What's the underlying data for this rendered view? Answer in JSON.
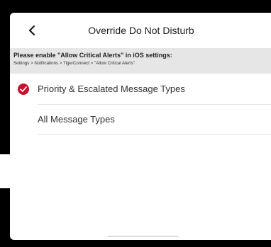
{
  "nav": {
    "title": "Override Do Not Disturb",
    "back_icon": "chevron-left-icon"
  },
  "banner": {
    "title": "Please enable \"Allow Critical Alerts\" in iOS settings:",
    "path": "Settings > Notifications > TigerConnect > \"Allow Critical Alerts\""
  },
  "options": [
    {
      "label": "Priority & Escalated Message Types",
      "selected": true,
      "icon": "check-circle-icon"
    },
    {
      "label": "All Message Types",
      "selected": false
    }
  ],
  "colors": {
    "accent": "#c8102e",
    "banner_bg": "#e6e6e6"
  }
}
